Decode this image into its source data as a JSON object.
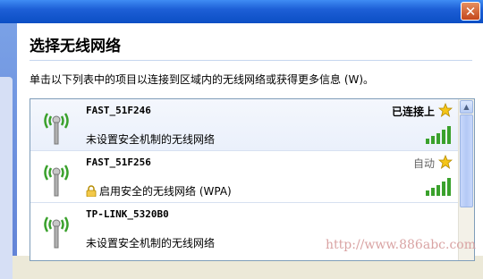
{
  "dialog": {
    "title": "选择无线网络",
    "instruction": "单击以下列表中的项目以连接到区域内的无线网络或获得更多信息 (W)。"
  },
  "networks": [
    {
      "name": "FAST_51F246",
      "description": "未设置安全机制的无线网络",
      "status": "已连接上",
      "secured": false,
      "signal_bars": 5
    },
    {
      "name": "FAST_51F256",
      "description": "启用安全的无线网络 (WPA)",
      "status": "自动",
      "secured": true,
      "signal_bars": 5
    },
    {
      "name": "TP-LINK_5320B0",
      "description": "未设置安全机制的无线网络",
      "status": "",
      "secured": false,
      "signal_bars": 0
    }
  ],
  "window": {
    "close_symbol": "✕"
  },
  "watermark": "http://www.886abc.com",
  "colors": {
    "signal_green": "#3aa12c",
    "star_yellow": "#f5c518",
    "title_blue": "#0b4ec4"
  }
}
